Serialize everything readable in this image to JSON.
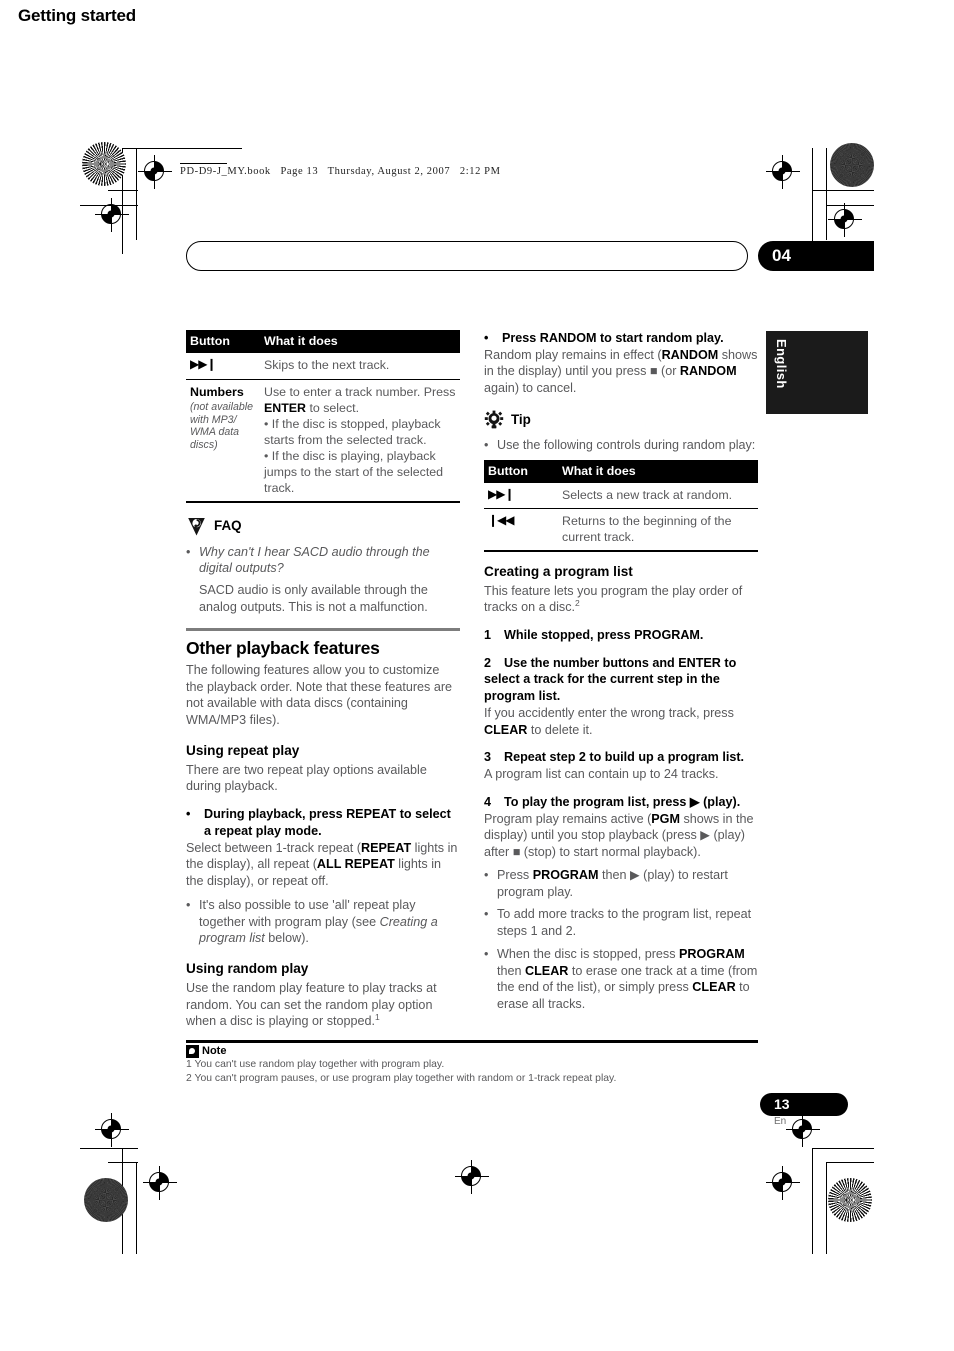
{
  "print_marks": {
    "file_stamp": "PD-D9-J_MY.book   Page 13   Thursday, August 2, 2007   2:12 PM"
  },
  "running_head": {
    "title": "Getting started",
    "chapter_number": "04"
  },
  "side_tab": {
    "language": "English"
  },
  "left_column": {
    "button_table": {
      "headers": [
        "Button",
        "What it does"
      ],
      "rows": [
        {
          "button": "▶▶❙",
          "button_note": "",
          "description": "Skips to the next track."
        },
        {
          "button": "Numbers",
          "button_note": "(not available with MP3/ WMA data discs)",
          "description_lead": "Use to enter a track number. Press ",
          "description_bold": "ENTER",
          "description_tail": " to select.",
          "bullets": [
            "If the disc is stopped, playback starts from the selected track.",
            "If the disc is playing, playback jumps to the start of the selected track."
          ]
        }
      ]
    },
    "faq": {
      "icon": "faq-icon",
      "label": "FAQ",
      "question": "Why can't I hear SACD audio through the digital outputs?",
      "answer": "SACD audio is only available through the analog outputs. This is not a malfunction."
    },
    "other_playback_features": {
      "heading": "Other playback features",
      "intro": "The following features allow you to customize the playback order. Note that these features are not available with data discs (containing WMA/MP3 files)."
    },
    "using_repeat_play": {
      "heading": "Using repeat play",
      "intro": "There are two repeat play options available during playback.",
      "bullet_strong": "During playback, press REPEAT to select a repeat play mode.",
      "body_part1": "Select between 1-track repeat (",
      "body_bold1": "REPEAT",
      "body_part2": " lights in the display), all repeat (",
      "body_bold2": "ALL REPEAT",
      "body_part3": " lights in the display), or repeat off.",
      "sub_bullet_part1": "It's also possible to use 'all' repeat play together with program play (see ",
      "sub_bullet_italic": "Creating a program list",
      "sub_bullet_part2": " below)."
    },
    "using_random_play": {
      "heading": "Using random play",
      "body": "Use the random play feature to play tracks at random. You can set the random play option when a disc is playing or stopped.",
      "footnote_marker": "1"
    }
  },
  "right_column": {
    "random_bullet": {
      "bullet_strong": "Press RANDOM to start random play.",
      "body_part1": "Random play remains in effect (",
      "body_bold1": "RANDOM",
      "body_part2": " shows in the display) until you press ■ (or ",
      "body_bold2": "RANDOM",
      "body_part3": " again) to cancel."
    },
    "tip": {
      "icon": "tip-icon",
      "label": "Tip",
      "bullet": "Use the following controls during random play:"
    },
    "random_table": {
      "headers": [
        "Button",
        "What it does"
      ],
      "rows": [
        {
          "button": "▶▶❙",
          "description": "Selects a new track at random."
        },
        {
          "button": "❙◀◀",
          "description": "Returns to the beginning of the current track."
        }
      ]
    },
    "creating_program_list": {
      "heading": "Creating a program list",
      "intro": "This feature lets you program the play order of tracks on a disc.",
      "intro_footnote": "2",
      "steps": [
        {
          "number": "1",
          "title": "While stopped, press PROGRAM.",
          "body": ""
        },
        {
          "number": "2",
          "title": "Use the number buttons and ENTER to select a track for the current step in the program list.",
          "body_part1": "If you accidently enter the wrong track, press ",
          "body_bold": "CLEAR",
          "body_part2": " to delete it."
        },
        {
          "number": "3",
          "title": "Repeat step 2 to build up a program list.",
          "body": "A program list can contain up to 24 tracks."
        },
        {
          "number": "4",
          "title": "To play the program list, press ▶ (play).",
          "body_part1": "Program play remains active (",
          "body_bold": "PGM",
          "body_part2": " shows in the display) until you stop playback (press ▶ (play) after ■ (stop) to start normal playback)."
        }
      ],
      "sub_bullets": [
        {
          "part1": "Press ",
          "bold1": "PROGRAM",
          "part2": " then ▶ (play) to restart program play."
        },
        {
          "part1": "To add more tracks to the program list, repeat steps 1 and 2.",
          "bold1": "",
          "part2": ""
        },
        {
          "part1": "When the disc is stopped, press ",
          "bold1": "PROGRAM",
          "part2": " then ",
          "bold2": "CLEAR",
          "part3": " to erase one track at a time (from the end of the list), or simply press ",
          "bold3": "CLEAR",
          "part4": " to erase all tracks."
        }
      ]
    }
  },
  "notes": {
    "icon": "note-icon",
    "label": "Note",
    "items": [
      "1 You can't use random play together with program play.",
      "2 You can't program pauses, or use program play together with random or 1-track repeat play."
    ]
  },
  "folio": {
    "page_number": "13",
    "language_code": "En"
  }
}
